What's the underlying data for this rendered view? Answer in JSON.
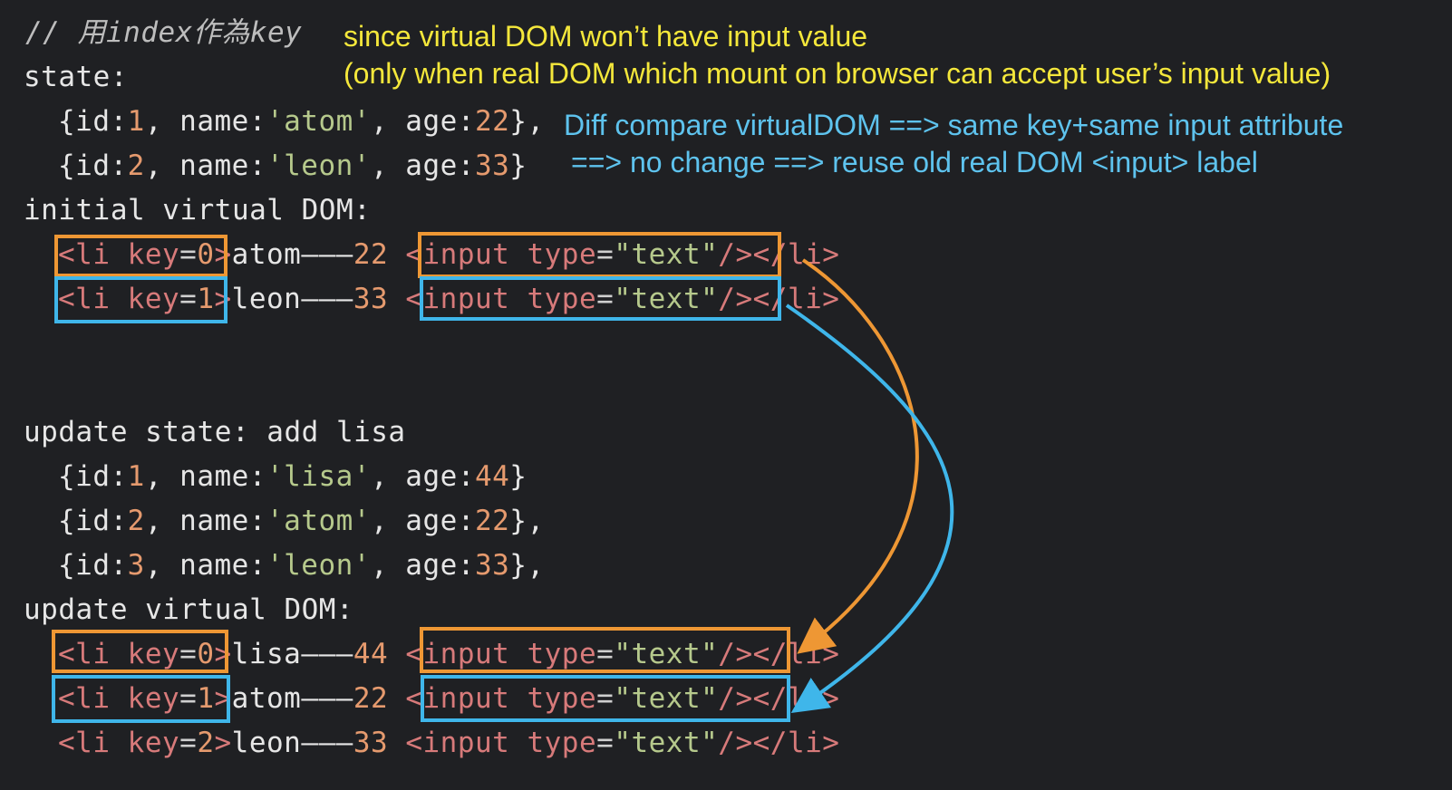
{
  "comment": "// 用index作為key",
  "note_yellow_1": "since virtual DOM won’t have input value",
  "note_yellow_2": "(only when real DOM which mount on browser can accept user’s input value)",
  "note_blue_1": "Diff compare virtualDOM ==> same key+same input attribute",
  "note_blue_2": "==> no change ==> reuse old real DOM <input> label",
  "state_label": "state:",
  "initial_state": [
    {
      "id": "1",
      "name": "'atom'",
      "age": "22",
      "trail": "},"
    },
    {
      "id": "2",
      "name": "'leon'",
      "age": "33",
      "trail": "}"
    }
  ],
  "initial_vdom_label": "initial virtual DOM:",
  "update_state_label": "update state: add lisa",
  "update_state": [
    {
      "id": "1",
      "name": "'lisa'",
      "age": "44",
      "trail": "}"
    },
    {
      "id": "2",
      "name": "'atom'",
      "age": "22",
      "trail": "},"
    },
    {
      "id": "3",
      "name": "'leon'",
      "age": "33",
      "trail": "},"
    }
  ],
  "update_vdom_label": "update virtual DOM:",
  "initial_vdom": [
    {
      "key": "0",
      "name": "atom",
      "age": "22"
    },
    {
      "key": "1",
      "name": "leon",
      "age": "33"
    }
  ],
  "update_vdom": [
    {
      "key": "0",
      "name": "lisa",
      "age": "44"
    },
    {
      "key": "1",
      "name": "atom",
      "age": "22"
    },
    {
      "key": "2",
      "name": "leon",
      "age": "33"
    }
  ],
  "syntax": {
    "li_open": "<li key",
    "eq": "=",
    "gt": ">",
    "dash": "———",
    "input_open": "<input type",
    "input_value": "\"text\"",
    "self_close": "/>",
    "li_close": "</li>",
    "id_key": "{id:",
    "name_key": ", name:",
    "age_key": ", age:"
  },
  "colors": {
    "orange": "#ee9734",
    "cyan": "#3fb6ea",
    "yellow": "#f4e73b",
    "blue_text": "#5ec3ee"
  }
}
